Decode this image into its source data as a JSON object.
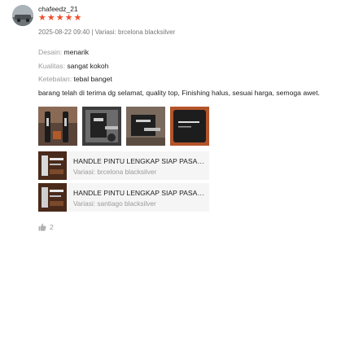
{
  "review": {
    "username": "chafeedz_21",
    "rating": 5,
    "meta": "2025-08-22 09:40 | Variasi: brcelona blacksilver",
    "attributes": [
      {
        "label": "Desain:",
        "value": "menarik"
      },
      {
        "label": "Kualitas:",
        "value": "sangat kokoh"
      },
      {
        "label": "Ketebalan:",
        "value": "tebal banget"
      }
    ],
    "comment": "barang telah di terima dg selamat, quality top, Finishing halus, sesuai harga, semoga awet.",
    "photos": [
      "review-photo-1",
      "review-photo-2",
      "review-photo-3",
      "review-photo-4"
    ],
    "products": [
      {
        "name": "HANDLE PINTU LENGKAP SIAP PASANG",
        "variation": "Variasi: brcelona blacksilver"
      },
      {
        "name": "HANDLE PINTU LENGKAP SIAP PASANG",
        "variation": "Variasi: santiago blacksilver"
      }
    ],
    "likes": "2"
  },
  "icons": {
    "star": "star-icon",
    "like": "thumbs-up-icon"
  },
  "colors": {
    "star": "#ee4d2d",
    "product_bg": "#f5f5f5",
    "muted_text": "#9a9a9a",
    "thumb_bg": "#4a2a1a"
  }
}
